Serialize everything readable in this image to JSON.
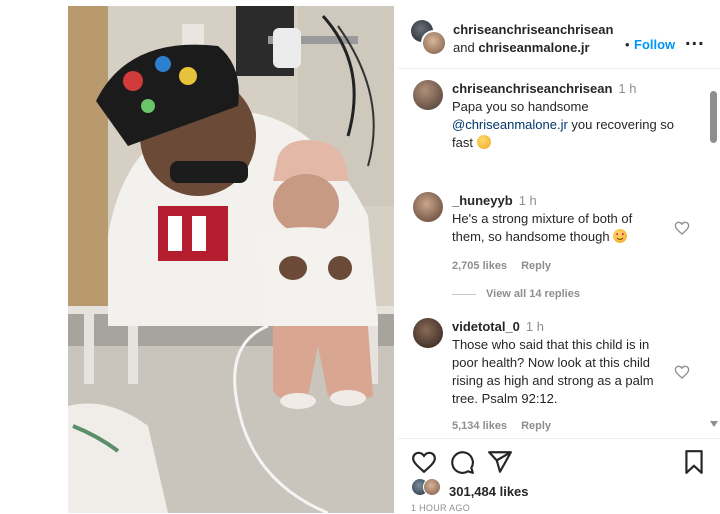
{
  "post": {
    "header": {
      "author": "chriseanchriseanchrisean",
      "and_word": "and",
      "coauthor": "chriseanmalone.jr",
      "dot": "•",
      "follow_label": "Follow",
      "menu_label": "..."
    },
    "caption": {
      "username": "chriseanchriseanchrisean",
      "time": "1 h",
      "text_1": "Papa you so handsome",
      "mention": "@chriseanmalone.jr",
      "text_2": " you recovering so",
      "text_3": "fast"
    },
    "comments": [
      {
        "username": "_huneyyb",
        "time": "1 h",
        "line_1": "He's a strong mixture of both of",
        "line_2": "them, so handsome though",
        "likes": "2,705 likes",
        "reply_label": "Reply"
      },
      {
        "username": "videtotal_0",
        "time": "1 h",
        "line_1": "Those who said that this child is in",
        "line_2": "poor health? Now look at this child",
        "line_3": "rising as high and strong as a palm",
        "line_4": "tree. Psalm 92:12.",
        "likes": "5,134 likes",
        "reply_label": "Reply"
      }
    ],
    "view_replies": "View all 14 replies",
    "like_count": "301,484 likes",
    "posted_ago": "1 HOUR AGO"
  },
  "colors": {
    "accent": "#0095f6",
    "text": "#262626",
    "muted": "#8e8e8e"
  },
  "icons": [
    "heart-icon",
    "comment-icon",
    "share-icon",
    "bookmark-icon",
    "more-icon"
  ]
}
